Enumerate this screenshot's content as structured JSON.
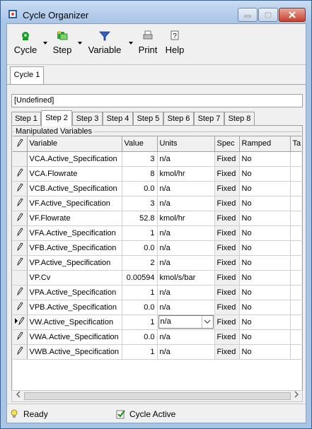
{
  "window": {
    "title": "Cycle Organizer"
  },
  "toolbar": {
    "cycle_label": "Cycle",
    "step_label": "Step",
    "variable_label": "Variable",
    "print_label": "Print",
    "help_label": "Help"
  },
  "cycle_tabs": [
    "Cycle 1"
  ],
  "description_value": "[Undefined]",
  "step_tabs": [
    "Step 1",
    "Step 2",
    "Step 3",
    "Step 4",
    "Step 5",
    "Step 6",
    "Step 7",
    "Step 8"
  ],
  "active_step": "Step 2",
  "group": {
    "label": "Manipulated Variables"
  },
  "grid": {
    "headers": {
      "variable": "Variable",
      "value": "Value",
      "units": "Units",
      "spec": "Spec",
      "ramped": "Ramped",
      "extra": "Ta"
    },
    "rows": [
      {
        "variable": "VCA.Active_Specification",
        "value": "3",
        "units": "n/a",
        "spec": "Fixed",
        "ramped": "No"
      },
      {
        "variable": "VCA.Flowrate",
        "value": "8",
        "units": "kmol/hr",
        "spec": "Fixed",
        "ramped": "No"
      },
      {
        "variable": "VCB.Active_Specification",
        "value": "0.0",
        "units": "n/a",
        "spec": "Fixed",
        "ramped": "No"
      },
      {
        "variable": "VF.Active_Specification",
        "value": "3",
        "units": "n/a",
        "spec": "Fixed",
        "ramped": "No"
      },
      {
        "variable": "VF.Flowrate",
        "value": "52.8",
        "units": "kmol/hr",
        "spec": "Fixed",
        "ramped": "No"
      },
      {
        "variable": "VFA.Active_Specification",
        "value": "1",
        "units": "n/a",
        "spec": "Fixed",
        "ramped": "No"
      },
      {
        "variable": "VFB.Active_Specification",
        "value": "0.0",
        "units": "n/a",
        "spec": "Fixed",
        "ramped": "No"
      },
      {
        "variable": "VP.Active_Specification",
        "value": "2",
        "units": "n/a",
        "spec": "Fixed",
        "ramped": "No"
      },
      {
        "variable": "VP.Cv",
        "value": "0.00594",
        "units": "kmol/s/bar",
        "spec": "Fixed",
        "ramped": "No"
      },
      {
        "variable": "VPA.Active_Specification",
        "value": "1",
        "units": "n/a",
        "spec": "Fixed",
        "ramped": "No"
      },
      {
        "variable": "VPB.Active_Specification",
        "value": "0.0",
        "units": "n/a",
        "spec": "Fixed",
        "ramped": "No"
      },
      {
        "variable": "VW.Active_Specification",
        "value": "1",
        "units": "n/a",
        "spec": "Fixed",
        "ramped": "No"
      },
      {
        "variable": "VWA.Active_Specification",
        "value": "0.0",
        "units": "n/a",
        "spec": "Fixed",
        "ramped": "No"
      },
      {
        "variable": "VWB.Active_Specification",
        "value": "1",
        "units": "n/a",
        "spec": "Fixed",
        "ramped": "No"
      }
    ]
  },
  "status": {
    "ready": "Ready",
    "cycle_active": "Cycle Active"
  }
}
